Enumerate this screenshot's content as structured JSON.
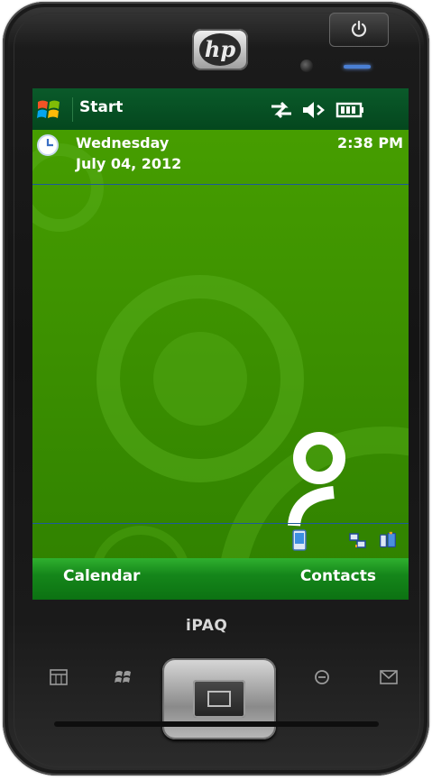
{
  "device": {
    "brand_logo": "hp",
    "model_label": "iPAQ"
  },
  "titlebar": {
    "start_label": "Start",
    "start_icon": "windows-flag-icon",
    "status_icons": [
      "connectivity-icon",
      "speaker-muted-icon",
      "battery-icon"
    ]
  },
  "today": {
    "day": "Wednesday",
    "date": "July 04, 2012",
    "time": "2:38 PM"
  },
  "tray": {
    "icons": [
      "device-sync-icon",
      "network-icon",
      "bluetooth-devices-icon"
    ]
  },
  "softkeys": {
    "left": "Calendar",
    "right": "Contacts"
  },
  "hardware_buttons": [
    "calendar-button-icon",
    "windows-start-button-icon",
    "ok-button-icon",
    "mail-button-icon"
  ],
  "colors": {
    "screen_green": "#3f9300",
    "titlebar_green": "#04471e",
    "softkey_green": "#15861a",
    "divider_blue": "#1d5a9a"
  }
}
